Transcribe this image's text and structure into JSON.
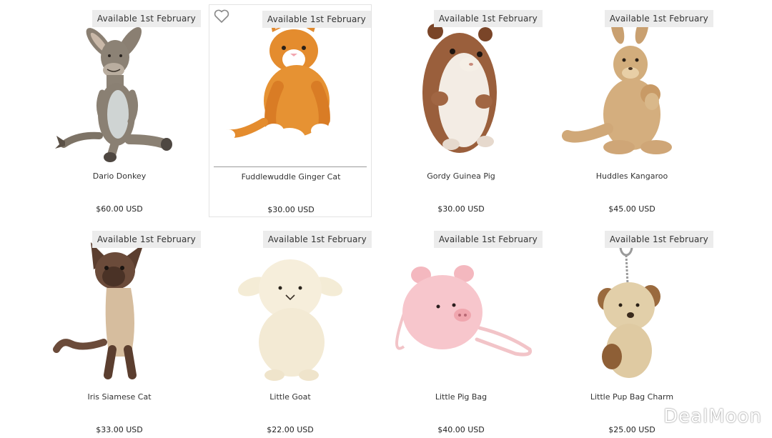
{
  "products": [
    {
      "name": "Dario Donkey",
      "price": "$60.00 USD",
      "badge": "Available 1st February",
      "icon": "donkey-plush"
    },
    {
      "name": "Fuddlewuddle Ginger Cat",
      "price": "$30.00 USD",
      "badge": "Available 1st February",
      "icon": "ginger-cat-plush"
    },
    {
      "name": "Gordy Guinea Pig",
      "price": "$30.00 USD",
      "badge": "Available 1st February",
      "icon": "guinea-pig-plush"
    },
    {
      "name": "Huddles Kangaroo",
      "price": "$45.00 USD",
      "badge": "Available 1st February",
      "icon": "kangaroo-plush"
    },
    {
      "name": "Iris Siamese Cat",
      "price": "$33.00 USD",
      "badge": "Available 1st February",
      "icon": "siamese-cat-plush"
    },
    {
      "name": "Little Goat",
      "price": "$22.00 USD",
      "badge": "Available 1st February",
      "icon": "goat-plush"
    },
    {
      "name": "Little Pig Bag",
      "price": "$40.00 USD",
      "badge": "Available 1st February",
      "icon": "pig-bag-plush"
    },
    {
      "name": "Little Pup Bag Charm",
      "price": "$25.00 USD",
      "badge": "Available 1st February",
      "icon": "pup-bag-charm-plush"
    }
  ],
  "watermark": "DealMoon",
  "colors": {
    "badge_bg": "#ececec",
    "text": "#222222"
  }
}
